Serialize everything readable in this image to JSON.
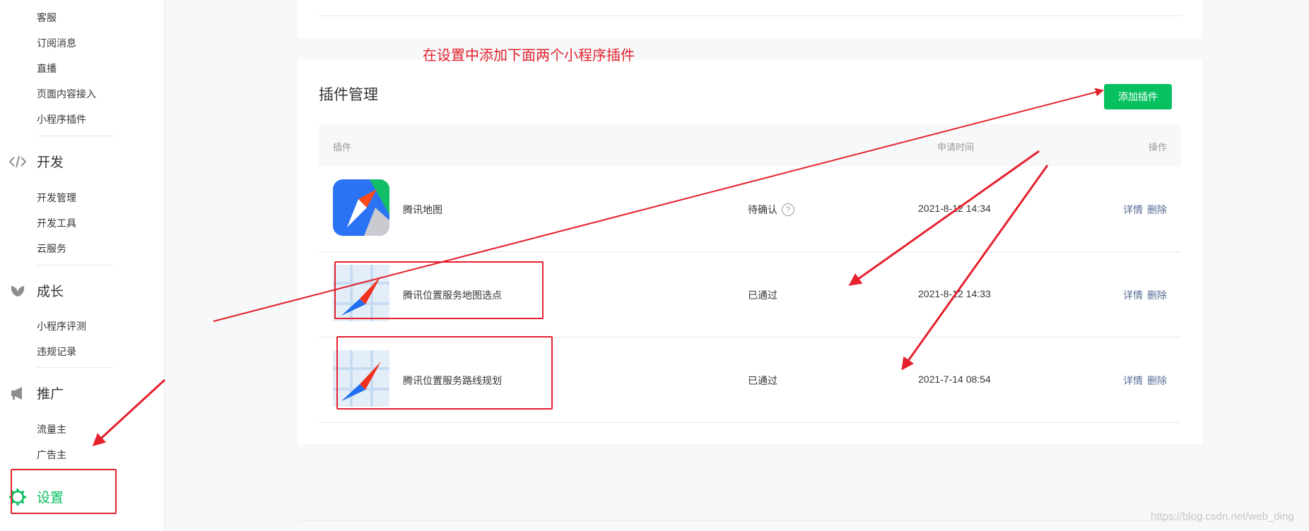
{
  "sidebar": {
    "items_top": [
      "客服",
      "订阅消息",
      "直播",
      "页面内容接入",
      "小程序插件"
    ],
    "dev": {
      "label": "开发",
      "icon": "code-icon",
      "items": [
        "开发管理",
        "开发工具",
        "云服务"
      ]
    },
    "growth": {
      "label": "成长",
      "icon": "leaf-icon",
      "items": [
        "小程序评测",
        "违规记录"
      ]
    },
    "promo": {
      "label": "推广",
      "icon": "megaphone-icon",
      "items": [
        "流量主",
        "广告主"
      ]
    },
    "settings": {
      "label": "设置",
      "icon": "gear-icon"
    }
  },
  "annotation": {
    "text": "在设置中添加下面两个小程序插件",
    "color": "#e4212d"
  },
  "plugins": {
    "title": "插件管理",
    "add_button": "添加插件",
    "headers": {
      "plugin": "插件",
      "time": "申请时间",
      "ops": "操作"
    },
    "rows": [
      {
        "name": "腾讯地图",
        "status": "待确认",
        "time": "2021-8-12 14:34",
        "detail": "详情",
        "delete": "删除",
        "logo": "tencent-map-icon"
      },
      {
        "name": "腾讯位置服务地图选点",
        "status": "已通过",
        "time": "2021-8-12 14:33",
        "detail": "详情",
        "delete": "删除",
        "logo": "compass-map-icon"
      },
      {
        "name": "腾讯位置服务路线规划",
        "status": "已通过",
        "time": "2021-7-14 08:54",
        "detail": "详情",
        "delete": "删除",
        "logo": "compass-map-icon"
      }
    ]
  },
  "watermark": "https://blog.csdn.net/web_ding",
  "colors": {
    "accent": "#07c160",
    "link": "#576b95",
    "annotation_red": "#e4212d"
  }
}
